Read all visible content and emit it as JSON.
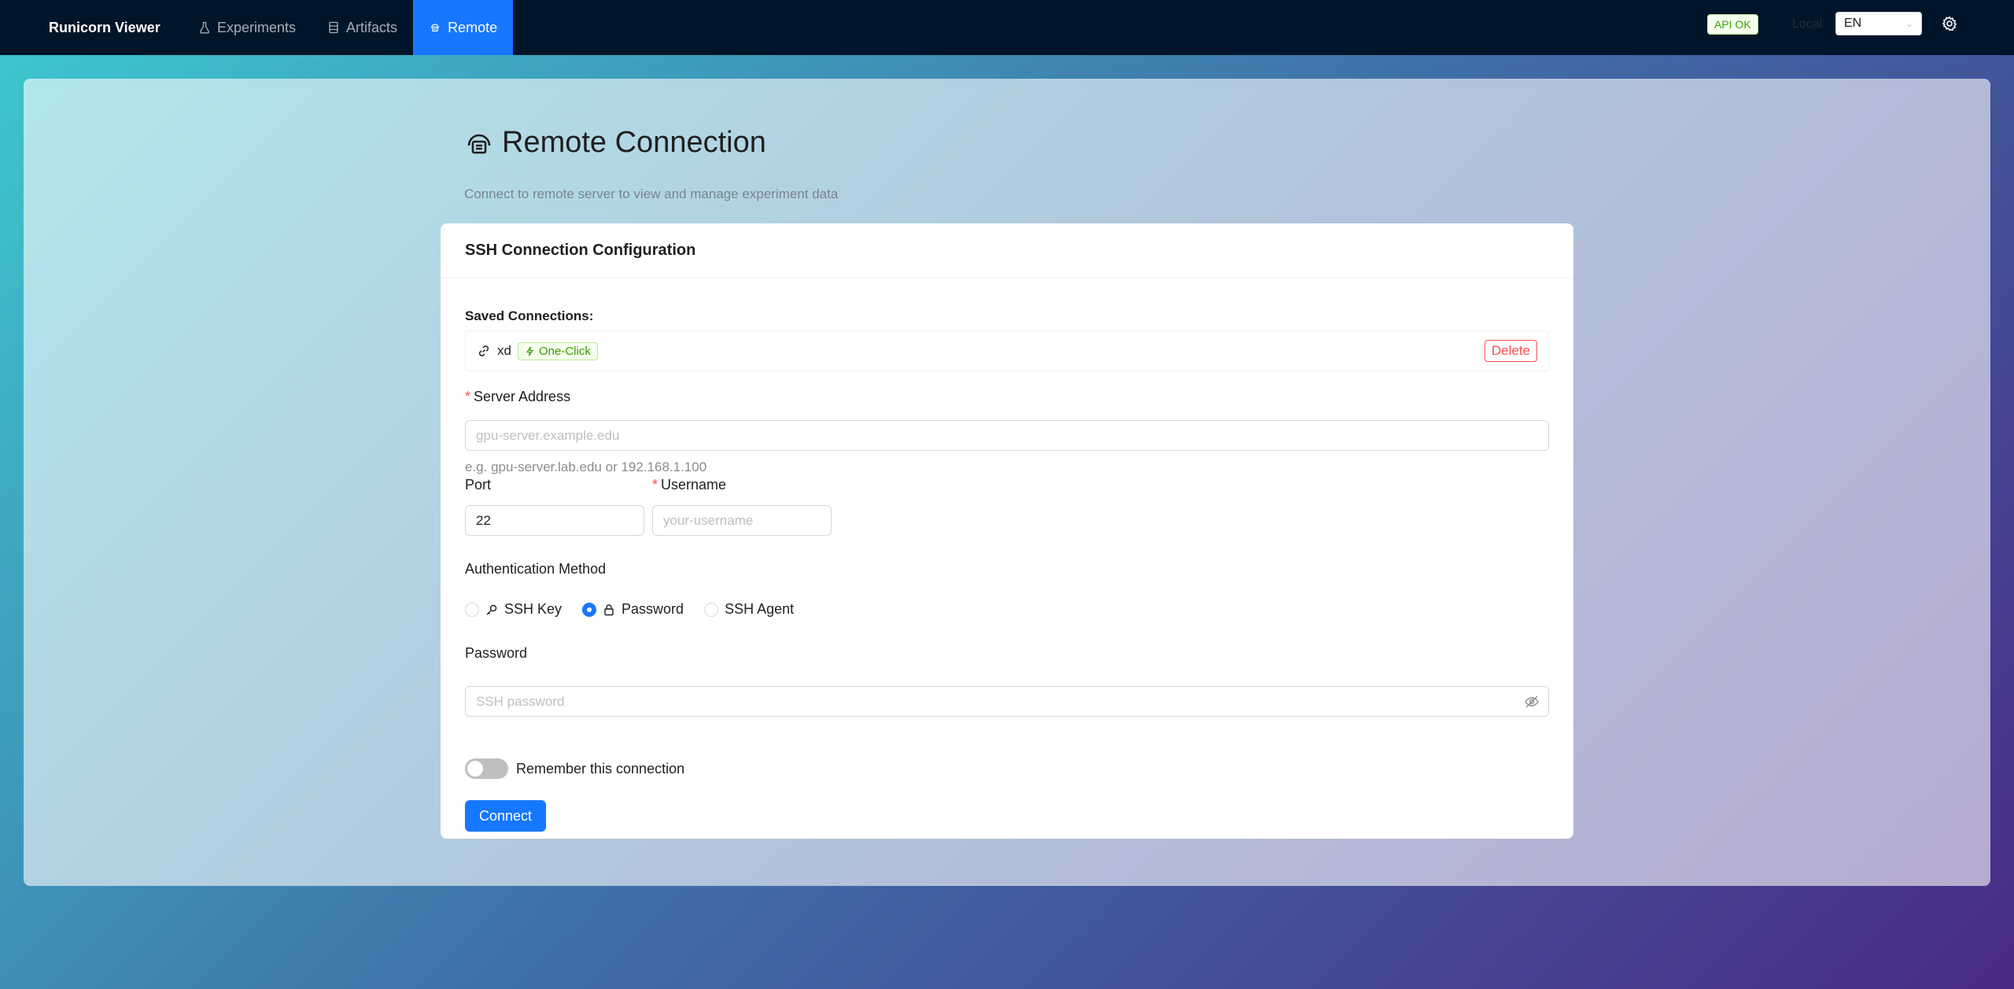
{
  "app": {
    "title": "Runicorn Viewer"
  },
  "nav": {
    "items": [
      {
        "label": "Experiments",
        "icon": "flask-icon"
      },
      {
        "label": "Artifacts",
        "icon": "database-icon"
      },
      {
        "label": "Remote",
        "icon": "cloud-server-icon",
        "active": true
      }
    ]
  },
  "header_right": {
    "api_status": "API OK",
    "mode": "Local",
    "language": "EN"
  },
  "page": {
    "title": "Remote Connection",
    "subtitle": "Connect to remote server to view and manage experiment data"
  },
  "card": {
    "title": "SSH Connection Configuration",
    "saved_label": "Saved Connections:",
    "saved": [
      {
        "name": "xd",
        "tag": "One-Click",
        "delete_label": "Delete"
      }
    ],
    "server": {
      "label": "Server Address",
      "placeholder": "gpu-server.example.edu",
      "help": "e.g. gpu-server.lab.edu or 192.168.1.100"
    },
    "port": {
      "label": "Port",
      "value": "22"
    },
    "username": {
      "label": "Username",
      "placeholder": "your-username"
    },
    "auth": {
      "label": "Authentication Method",
      "options": [
        "SSH Key",
        "Password",
        "SSH Agent"
      ],
      "selected": "Password"
    },
    "password": {
      "label": "Password",
      "placeholder": "SSH password"
    },
    "remember": {
      "label": "Remember this connection",
      "on": false
    },
    "connect_label": "Connect"
  },
  "colors": {
    "primary": "#1677ff",
    "nav_bg": "#001529",
    "danger": "#ff4d4f",
    "success": "#389e0d"
  }
}
